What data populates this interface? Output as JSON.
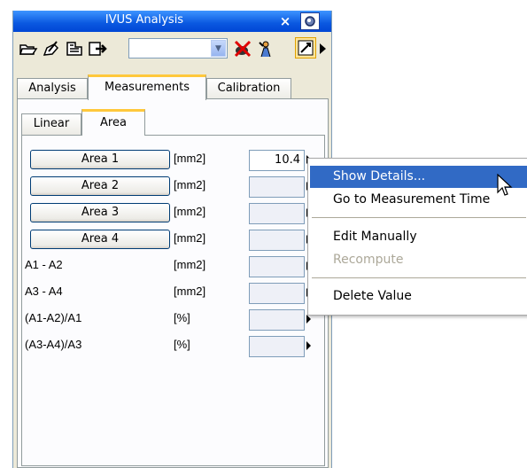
{
  "window": {
    "title": "IVUS Analysis",
    "close_glyph": "×"
  },
  "toolbar": {
    "icons": [
      "open-folder-icon",
      "edit-pen-icon",
      "cut-icon",
      "export-icon"
    ],
    "combo_value": "",
    "right_icons": [
      "delete-measurement-icon",
      "person-pointer-icon",
      "highlight-icon"
    ]
  },
  "tabs": [
    "Analysis",
    "Measurements",
    "Calibration"
  ],
  "active_tab": "Measurements",
  "subtabs": [
    "Linear",
    "Area"
  ],
  "active_subtab": "Area",
  "measurements": [
    {
      "label": "Area 1",
      "unit": "[mm2]",
      "value": "10.4",
      "button": true
    },
    {
      "label": "Area 2",
      "unit": "[mm2]",
      "value": "",
      "button": true
    },
    {
      "label": "Area 3",
      "unit": "[mm2]",
      "value": "",
      "button": true
    },
    {
      "label": "Area 4",
      "unit": "[mm2]",
      "value": "",
      "button": true
    },
    {
      "label": "A1 - A2",
      "unit": "[mm2]",
      "value": "",
      "button": false
    },
    {
      "label": "A3 - A4",
      "unit": "[mm2]",
      "value": "",
      "button": false
    },
    {
      "label": "(A1-A2)/A1",
      "unit": "[%]",
      "value": "",
      "button": false
    },
    {
      "label": "(A3-A4)/A3",
      "unit": "[%]",
      "value": "",
      "button": false
    }
  ],
  "context_menu": {
    "items": [
      {
        "label": "Show Details...",
        "state": "selected"
      },
      {
        "label": "Go to Measurement Time",
        "state": "normal"
      },
      {
        "label": "Edit Manually",
        "state": "normal"
      },
      {
        "label": "Recompute",
        "state": "disabled"
      },
      {
        "label": "Delete Value",
        "state": "normal"
      }
    ]
  },
  "colors": {
    "titlebar": "#0a58e0",
    "selection": "#316ac5",
    "tab_accent": "#ffc83c"
  }
}
